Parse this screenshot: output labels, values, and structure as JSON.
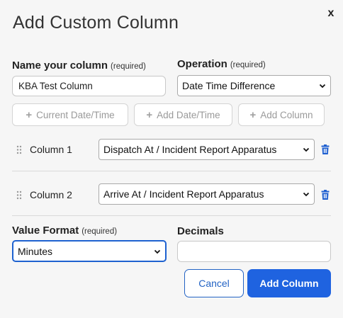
{
  "dialog": {
    "title": "Add Custom Column",
    "close_label": "x"
  },
  "name_field": {
    "label": "Name your column",
    "required": "(required)",
    "value": "KBA Test Column"
  },
  "operation_field": {
    "label": "Operation",
    "required": "(required)",
    "value": "Date Time Difference"
  },
  "chips": [
    {
      "label": "Current Date/Time"
    },
    {
      "label": "Add Date/Time"
    },
    {
      "label": "Add Column"
    }
  ],
  "columns": [
    {
      "label": "Column 1",
      "value": "Dispatch At / Incident Report Apparatus"
    },
    {
      "label": "Column 2",
      "value": "Arrive At / Incident Report Apparatus"
    }
  ],
  "value_format": {
    "label": "Value Format",
    "required": "(required)",
    "value": "Minutes"
  },
  "decimals": {
    "label": "Decimals",
    "value": ""
  },
  "buttons": {
    "cancel": "Cancel",
    "add": "Add Column"
  },
  "colors": {
    "primary": "#1f63e0",
    "trash": "#1e5fd0"
  }
}
